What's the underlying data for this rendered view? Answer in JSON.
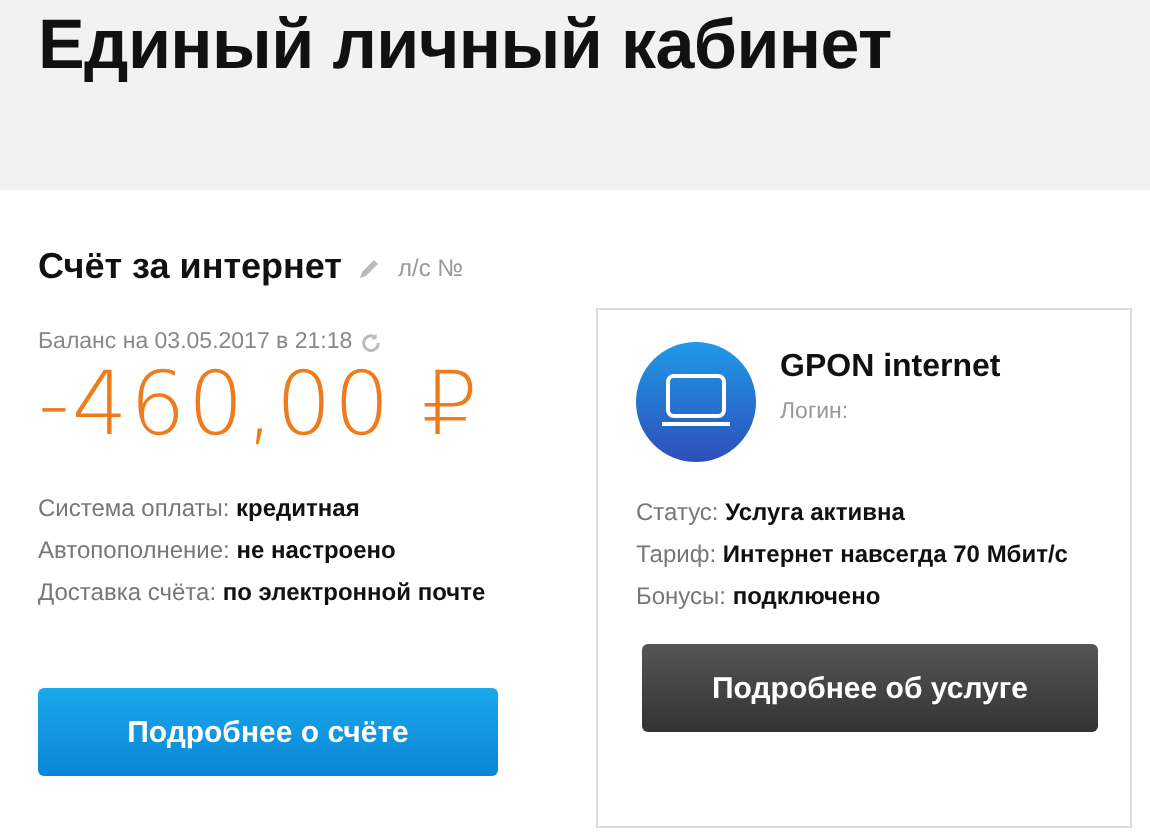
{
  "header": {
    "title": "Единый личный кабинет"
  },
  "account": {
    "title": "Счёт за интернет",
    "account_label": "л/с №",
    "balance_label": "Баланс на 03.05.2017 в 21:18",
    "balance": "-460,00 ₽",
    "details": [
      {
        "label": "Система оплаты:",
        "value": "кредитная"
      },
      {
        "label": "Автопополнение:",
        "value": "не настроено"
      },
      {
        "label": "Доставка счёта:",
        "value": "по электронной почте"
      }
    ],
    "button": "Подробнее о счёте"
  },
  "service": {
    "name": "GPON internet",
    "login_label": "Логин:",
    "details": [
      {
        "label": "Статус:",
        "value": "Услуга активна"
      },
      {
        "label": "Тариф:",
        "value": "Интернет навсегда 70 Мбит/с"
      },
      {
        "label": "Бонусы:",
        "value": "подключено"
      }
    ],
    "button": "Подробнее об услуге"
  }
}
